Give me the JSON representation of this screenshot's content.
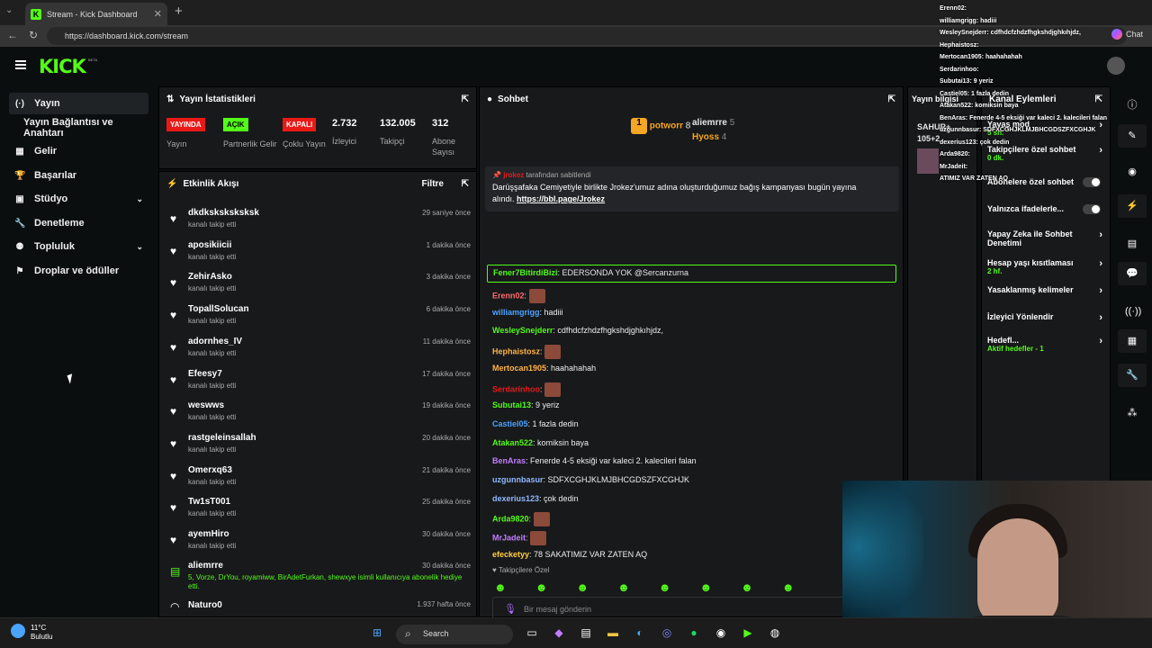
{
  "browser": {
    "tab_title": "Stream - Kick Dashboard",
    "url": "https://dashboard.kick.com/stream",
    "chat_button": "Chat"
  },
  "app": {
    "logo": "KICK",
    "beta": "BETA"
  },
  "sidebar": {
    "items": [
      {
        "label": "Yayın",
        "icon": "stream-icon"
      },
      {
        "label": "Yayın Bağlantısı ve Anahtarı",
        "icon": ""
      },
      {
        "label": "Gelir",
        "icon": "revenue-icon"
      },
      {
        "label": "Başarılar",
        "icon": "trophy-icon"
      },
      {
        "label": "Stüdyo",
        "icon": "studio-icon"
      },
      {
        "label": "Denetleme",
        "icon": "wrench-icon"
      },
      {
        "label": "Topluluk",
        "icon": "community-icon"
      },
      {
        "label": "Droplar ve ödüller",
        "icon": "drops-icon"
      }
    ]
  },
  "stats": {
    "title": "Yayın İstatistikleri",
    "live_badge": "YAYINDA",
    "live_label": "Yayın",
    "partner_badge": "AÇIK",
    "partner_label": "Partnerlik Gelir",
    "multi_badge": "KAPALI",
    "multi_label": "Çoklu Yayın",
    "viewers": "2.732",
    "viewers_label": "İzleyici",
    "followers": "132.005",
    "followers_label": "Takipçi",
    "subs": "312",
    "subs_label": "Abone Sayısı"
  },
  "activity": {
    "title": "Etkinlik Akışı",
    "filter": "Filtre",
    "rows": [
      {
        "name": "dkdksksksksksk",
        "sub": "kanalı takip etti",
        "time": "29 saniye önce"
      },
      {
        "name": "aposikiicii",
        "sub": "kanalı takip etti",
        "time": "1 dakika önce"
      },
      {
        "name": "ZehirAsko",
        "sub": "kanalı takip etti",
        "time": "3 dakika önce"
      },
      {
        "name": "TopallSolucan",
        "sub": "kanalı takip etti",
        "time": "6 dakika önce"
      },
      {
        "name": "adornhes_IV",
        "sub": "kanalı takip etti",
        "time": "11 dakika önce"
      },
      {
        "name": "Efeesy7",
        "sub": "kanalı takip etti",
        "time": "17 dakika önce"
      },
      {
        "name": "weswws",
        "sub": "kanalı takip etti",
        "time": "19 dakika önce"
      },
      {
        "name": "rastgeleinsallah",
        "sub": "kanalı takip etti",
        "time": "20 dakika önce"
      },
      {
        "name": "Omerxq63",
        "sub": "kanalı takip etti",
        "time": "21 dakika önce"
      },
      {
        "name": "Tw1sT001",
        "sub": "kanalı takip etti",
        "time": "25 dakika önce"
      },
      {
        "name": "ayemHiro",
        "sub": "kanalı takip etti",
        "time": "30 dakika önce"
      }
    ],
    "gift_row": {
      "name": "aliemrre",
      "time": "30 dakika önce",
      "text": "5, Vorze, DrYou, royamiww, BirAdetFurkan, shewxye isimli kullanıcıya abonelik hediye etti."
    },
    "last_row": {
      "name": "Naturo0",
      "time": "1.937 hafta önce"
    }
  },
  "chat": {
    "title": "Sohbet",
    "top1_name": "potworr",
    "top1_count": "8",
    "top2_name": "aliemrre",
    "top2_count": "5",
    "top3_name": "Hyoss",
    "top3_count": "4",
    "pin_by": "tarafından sabitlendi",
    "pin_text": "Darüşşafaka Cemiyetiyle birlikte Jrokez'umuz adına oluşturduğumuz bağış kampanyası bugün yayına alındı.",
    "pin_link": "https://bbl.page/Jrokez",
    "highlight_user": "Fener7BitirdiBizi",
    "highlight_text": ": EDERSONDA YOK @Sercanzurna",
    "messages": [
      {
        "user": "Erenn02",
        "text": ":",
        "color": "#ff6b6b"
      },
      {
        "user": "williamgrigg",
        "text": ": hadiii",
        "color": "#4aa3ff"
      },
      {
        "user": "WesleySnejderr",
        "text": ": cdfhdcfzhdzfhgkshdjghkıhjdz,",
        "color": "#53fc18"
      },
      {
        "user": "Hephaistosz",
        "text": ":",
        "color": "#ffb347"
      },
      {
        "user": "Mertocan1905",
        "text": ": haahahahah",
        "color": "#ffb347"
      },
      {
        "user": "Serdarinhoo",
        "text": ":",
        "color": "#e91916"
      },
      {
        "user": "Subutai13",
        "text": ": 9 yeriz",
        "color": "#53fc18"
      },
      {
        "user": "Castiel05",
        "text": ": 1 fazla dedin",
        "color": "#4aa3ff"
      },
      {
        "user": "Atakan522",
        "text": ": komiksin baya",
        "color": "#53fc18"
      },
      {
        "user": "BenAras",
        "text": ": Fenerde 4-5 eksiği var kaleci 2. kalecileri falan",
        "color": "#c27dff"
      },
      {
        "user": "uzgunnbasur",
        "text": ": SDFXCGHJKLMJBHCGDSZFXCGHJK",
        "color": "#8fb8ff"
      },
      {
        "user": "dexerius123",
        "text": ": çok dedin",
        "color": "#8fb8ff"
      },
      {
        "user": "Arda9820",
        "text": ":",
        "color": "#53fc18"
      },
      {
        "user": "MrJadeit",
        "text": ":",
        "color": "#c27dff"
      },
      {
        "user": "efecketyy",
        "text": ": 78 SAKATIMIZ VAR ZATEN AQ",
        "color": "#ffcf40"
      }
    ],
    "followers_only": "Takipçilere Özel",
    "placeholder": "Bir mesaj gönderin",
    "foot_count": "0"
  },
  "info": {
    "title": "Yayın bilgisi",
    "line1": "SAHUR+",
    "line2": "105+2"
  },
  "actions": {
    "title": "Kanal Eylemleri",
    "items": [
      {
        "label": "Yavaş mod",
        "sub": "5 sn."
      },
      {
        "label": "Takipçilere özel sohbet",
        "sub": "0 dk."
      },
      {
        "label": "Abonelere özel sohbet",
        "sub": ""
      },
      {
        "label": "Yalnızca ifadelerle...",
        "sub": ""
      },
      {
        "label": "Yapay Zeka ile Sohbet Denetimi",
        "sub": ""
      },
      {
        "label": "Hesap yaşı kısıtlaması",
        "sub": "2 hf."
      },
      {
        "label": "Yasaklanmış kelimeler",
        "sub": ""
      },
      {
        "label": "İzleyici Yönlendir",
        "sub": ""
      },
      {
        "label": "Hedefl...",
        "sub": "Aktif hedefler - 1"
      }
    ]
  },
  "overlay": {
    "lines": [
      "Erenn02:",
      "williamgrigg: hadiii",
      "WesleySnejderr: cdfhdcfzhdzfhgkshdjghkıhjdz,",
      "Hephaistosz:",
      "Mertocan1905: haahahahah",
      "Serdarinhoo:",
      "Subutai13: 9 yeriz",
      "Castiel05: 1 fazla dedin",
      "Atakan522: komiksin baya",
      "BenAras: Fenerde 4-5 eksiği var kaleci 2. kalecileri falan",
      "uzgunnbasur: SDFXCGHJKLMJBHCGDSZFXCGHJK",
      "dexerius123: çok dedin",
      "Arda9820:",
      "MrJadeit:",
      "ATIMIZ VAR ZATEN AQ"
    ]
  },
  "taskbar": {
    "temp": "11°C",
    "weather": "Bulutlu",
    "search": "Search"
  }
}
